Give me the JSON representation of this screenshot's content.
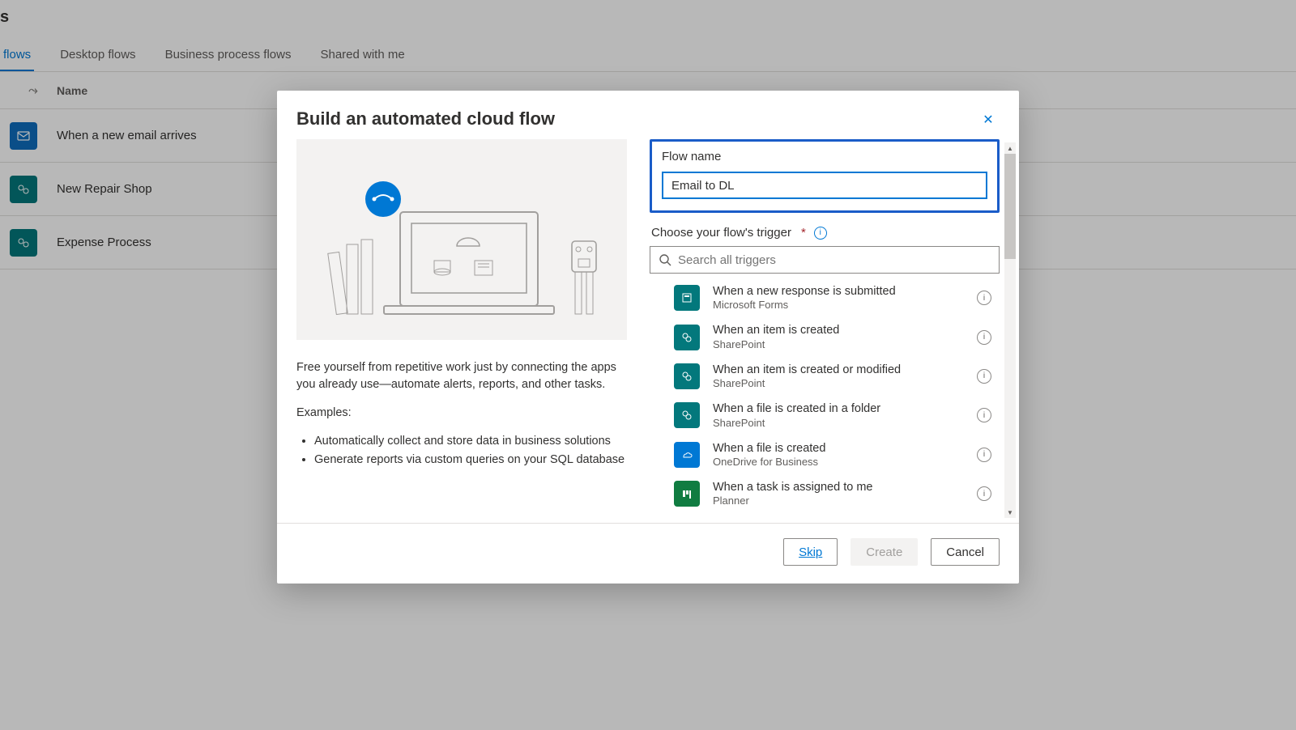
{
  "page": {
    "title_truncated": "s"
  },
  "tabs": [
    {
      "label": "flows",
      "active": true
    },
    {
      "label": "Desktop flows",
      "active": false
    },
    {
      "label": "Business process flows",
      "active": false
    },
    {
      "label": "Shared with me",
      "active": false
    }
  ],
  "list_header": {
    "name": "Name",
    "flow_icon_glyph": "⤳"
  },
  "flows": [
    {
      "name": "When a new email arrives",
      "icon_type": "outlook"
    },
    {
      "name": "New Repair Shop",
      "icon_type": "sharepoint"
    },
    {
      "name": "Expense Process",
      "icon_type": "sharepoint"
    }
  ],
  "dialog": {
    "title": "Build an automated cloud flow",
    "close_glyph": "✕",
    "left_description": "Free yourself from repetitive work just by connecting the apps you already use—automate alerts, reports, and other tasks.",
    "examples_heading": "Examples:",
    "examples": [
      "Automatically collect and store data in business solutions",
      "Generate reports via custom queries on your SQL database"
    ],
    "flow_name_label": "Flow name",
    "flow_name_value": "Email to DL",
    "trigger_label": "Choose your flow's trigger",
    "trigger_required": "*",
    "search_placeholder": "Search all triggers",
    "triggers": [
      {
        "title": "When a new response is submitted",
        "subtitle": "Microsoft Forms",
        "color": "forms"
      },
      {
        "title": "When an item is created",
        "subtitle": "SharePoint",
        "color": "sp"
      },
      {
        "title": "When an item is created or modified",
        "subtitle": "SharePoint",
        "color": "sp"
      },
      {
        "title": "When a file is created in a folder",
        "subtitle": "SharePoint",
        "color": "sp"
      },
      {
        "title": "When a file is created",
        "subtitle": "OneDrive for Business",
        "color": "od"
      },
      {
        "title": "When a task is assigned to me",
        "subtitle": "Planner",
        "color": "pl"
      }
    ],
    "buttons": {
      "skip": "Skip",
      "create": "Create",
      "cancel": "Cancel"
    }
  }
}
